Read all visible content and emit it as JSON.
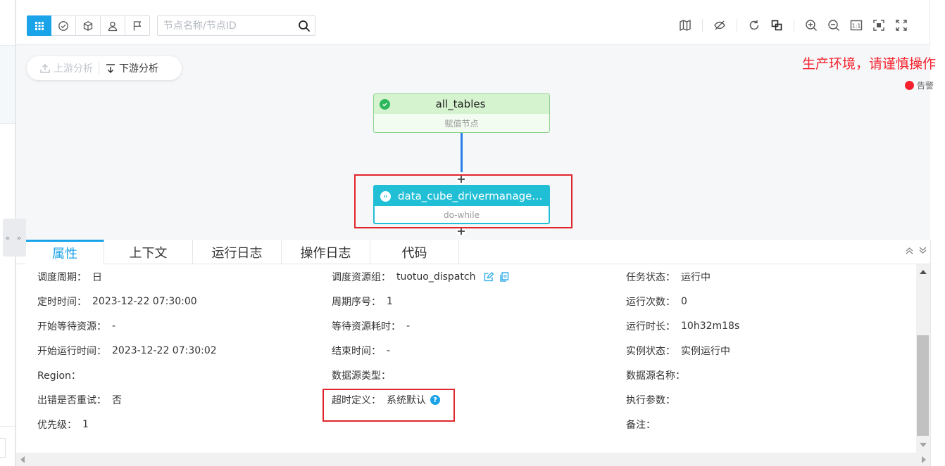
{
  "toolbar": {
    "search_placeholder": "节点名称/节点ID"
  },
  "canvas": {
    "upstream_label": "上游分析",
    "downstream_label": "下游分析",
    "env_warning": "生产环境，请谨慎操作",
    "alarm_label": "告警",
    "nodes": [
      {
        "name": "all_tables",
        "type": "赋值节点",
        "status": "success"
      },
      {
        "name": "data_cube_drivermanage_f...",
        "type": "do-while",
        "status": "running"
      }
    ]
  },
  "tabs": [
    "属性",
    "上下文",
    "运行日志",
    "操作日志",
    "代码"
  ],
  "properties": {
    "r1": {
      "l1": "调度周期：",
      "v1": "日",
      "l2": "调度资源组：",
      "v2": "tuotuo_dispatch",
      "l3": "任务状态：",
      "v3": "运行中"
    },
    "r2": {
      "l1": "定时时间：",
      "v1": "2023-12-22 07:30:00",
      "l2": "周期序号：",
      "v2": "1",
      "l3": "运行次数：",
      "v3": "0"
    },
    "r3": {
      "l1": "开始等待资源：",
      "v1": "-",
      "l2": "等待资源耗时：",
      "v2": "-",
      "l3": "运行时长：",
      "v3": "10h32m18s"
    },
    "r4": {
      "l1": "开始运行时间：",
      "v1": "2023-12-22 07:30:02",
      "l2": "结束时间：",
      "v2": "-",
      "l3": "实例状态：",
      "v3": "实例运行中"
    },
    "r5": {
      "l1": "Region：",
      "v1": "",
      "l2": "数据源类型：",
      "v2": "",
      "l3": "数据源名称：",
      "v3": ""
    },
    "r6": {
      "l1": "出错是否重试：",
      "v1": "否",
      "l2": "超时定义：",
      "v2": "系统默认",
      "l3": "执行参数：",
      "v3": ""
    },
    "r7": {
      "l1": "优先级：",
      "v1": "1",
      "l3": "备注：",
      "v3": ""
    }
  },
  "colors": {
    "accent": "#1aa3e8",
    "warning": "#f5222d",
    "success": "#2eb85c",
    "running": "#21bfd6"
  }
}
